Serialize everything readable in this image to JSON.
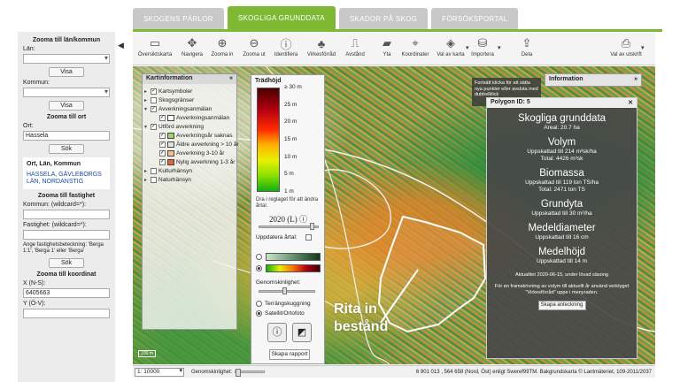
{
  "tabs": [
    {
      "label": "SKOGENS PÄRLOR",
      "active": false
    },
    {
      "label": "SKOGLIGA GRUNDDATA",
      "active": true
    },
    {
      "label": "SKADOR PÅ SKOG",
      "active": false
    },
    {
      "label": "FÖRSÖKSPORTAL",
      "active": false
    }
  ],
  "sidebar": {
    "zoom_lan_title": "Zooma till län/kommun",
    "lan_label": "Län:",
    "kommun_label": "Kommun:",
    "visa_label": "Visa",
    "zoom_ort_title": "Zooma till ort",
    "ort_label": "Ort:",
    "ort_value": "Hassela",
    "sok_label": "Sök",
    "result_title": "Ort, Län, Kommun",
    "result_link": "HASSELA, GÄVLEBORGS LÄN, NORDANSTIG",
    "zoom_fastighet_title": "Zooma till fastighet",
    "kommun_wild_label": "Kommun: (wildcard=*):",
    "fastighet_wild_label": "Fastighet: (wildcard=*):",
    "fastighet_hint": "Ange fastighetsbeteckning: 'Berga 1:1', 'Berga 1' eller 'Berga'",
    "zoom_koordinat_title": "Zooma till koordinat",
    "x_label": "X (N-S):",
    "x_value": "6405663",
    "y_label": "Y (Ö-V):"
  },
  "toolbar": {
    "items": [
      {
        "label": "Översiktskarta",
        "icon": "overview-map-icon",
        "glyph": "▭"
      },
      {
        "label": "Navigera",
        "icon": "pan-icon",
        "glyph": "✥"
      },
      {
        "label": "Zooma in",
        "icon": "zoom-in-icon",
        "glyph": "⊕"
      },
      {
        "label": "Zooma ut",
        "icon": "zoom-out-icon",
        "glyph": "⊖"
      },
      {
        "label": "Identifiera",
        "icon": "info-icon",
        "glyph": "ⓘ"
      },
      {
        "label": "Virkesförråd",
        "icon": "tree-icon",
        "glyph": "♣"
      },
      {
        "label": "Avstånd",
        "icon": "ruler-icon",
        "glyph": "⎍"
      },
      {
        "label": "Yta",
        "icon": "area-icon",
        "glyph": "▰"
      },
      {
        "label": "Koordinater",
        "icon": "crosshair-icon",
        "glyph": "⌖"
      },
      {
        "label": "Val av karta",
        "icon": "layers-icon",
        "glyph": "◈"
      },
      {
        "label": "Importera",
        "icon": "database-icon",
        "glyph": "⛁"
      },
      {
        "label": "Dela",
        "icon": "share-icon",
        "glyph": "⇪"
      },
      {
        "label": "Val av utskrift",
        "icon": "printer-icon",
        "glyph": "⎙"
      }
    ]
  },
  "kartinfo": {
    "title": "Kartinformation",
    "items": [
      {
        "label": "Kartsymboler",
        "level": 0,
        "checked": true,
        "toggle": "▸",
        "swatch": ""
      },
      {
        "label": "Skogsgränser",
        "level": 0,
        "checked": false,
        "toggle": "▸",
        "swatch": ""
      },
      {
        "label": "Avverkningsanmälan",
        "level": 0,
        "checked": true,
        "toggle": "▾",
        "swatch": ""
      },
      {
        "label": "Avverkningsanmälan",
        "level": 1,
        "checked": true,
        "toggle": "",
        "swatch": "#ffffff"
      },
      {
        "label": "Utförd avverkning",
        "level": 0,
        "checked": true,
        "toggle": "▾",
        "swatch": ""
      },
      {
        "label": "Avverkningsår saknas",
        "level": 1,
        "checked": true,
        "toggle": "",
        "swatch": "#9fd46a"
      },
      {
        "label": "Äldre avverkning > 10 år",
        "level": 1,
        "checked": true,
        "toggle": "",
        "swatch": "#e4e4e4"
      },
      {
        "label": "Avverkning 3-10 år",
        "level": 1,
        "checked": true,
        "toggle": "",
        "swatch": "#f0c090"
      },
      {
        "label": "Nylig avverkning 1-3 år",
        "level": 1,
        "checked": true,
        "toggle": "",
        "swatch": "#e86040"
      },
      {
        "label": "Kulturhänsyn",
        "level": 0,
        "checked": false,
        "toggle": "▸",
        "swatch": ""
      },
      {
        "label": "Naturhänsyn",
        "level": 0,
        "checked": false,
        "toggle": "▸",
        "swatch": ""
      }
    ]
  },
  "legend": {
    "title": "Trädhöjd",
    "ticks": [
      "≥ 30 m",
      "25 m",
      "20 m",
      "15 m",
      "10 m",
      "5 m",
      "1 m"
    ],
    "note": "Dra i reglaget för att ändra årtal.",
    "year": "2020 (L)",
    "update_label": "Uppdatera årtal:",
    "generalization_label": "Genomskinlighet:",
    "terrain_label": "Terrängskuggning",
    "satellite_label": "Satellit/Ortofoto",
    "create_report_label": "Skapa rapport"
  },
  "fortsatt_note": "Fortsätt klicka för att sätta nya punkter eller avsluta med dubbelklick",
  "info_panel_title": "Information",
  "polygon": {
    "title": "Polygon ID: 5",
    "sections": [
      {
        "heading": "Skogliga grunddata",
        "lines": [
          "Areal: 20.7 ha"
        ]
      },
      {
        "heading": "Volym",
        "lines": [
          "Uppskattad till 214 m³sk/ha",
          "Total: 4426 m³sk"
        ]
      },
      {
        "heading": "Biomassa",
        "lines": [
          "Uppskattad till 119 ton TS/ha",
          "Total: 2471 ton TS"
        ]
      },
      {
        "heading": "Grundyta",
        "lines": [
          "Uppskattad till 30 m²/ha"
        ]
      },
      {
        "heading": "Medeldiameter",
        "lines": [
          "Uppskattad till 16 cm"
        ]
      },
      {
        "heading": "Medelhöjd",
        "lines": [
          "Uppskattad till 14 m"
        ]
      }
    ],
    "updated": "Aktualitet 2020-06-15, under lövad säsong",
    "forecast_note": "För en framskrivning av volym till aktuellt år använd verktyget \"Virkesförråd\" uppe i menyraden.",
    "annotation_button": "Skapa anteckning"
  },
  "map_overlay_text": "Rita in bestånd",
  "scale_box": "100 m",
  "statusbar": {
    "scale": "1: 10000",
    "generalization_label": "Genomskinlighet:",
    "coords": "6 901 013 , 564 658 (Nord, Öst) enligt Sweref99TM. Bakgrundskarta © Lantmäteriet, 109-2011/2037"
  },
  "colors": {
    "accent": "#7fb832",
    "panel_dark": "#484848"
  }
}
